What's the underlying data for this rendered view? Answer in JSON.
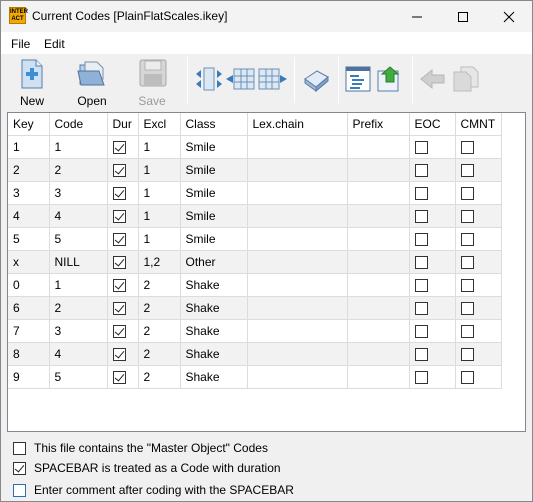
{
  "window": {
    "title": "Current Codes [PlainFlatScales.ikey]",
    "app_icon_text": "INTER ACT"
  },
  "menu": {
    "file": "File",
    "edit": "Edit"
  },
  "toolbar": {
    "new_label": "New",
    "open_label": "Open",
    "save_label": "Save"
  },
  "table": {
    "columns": [
      "Key",
      "Code",
      "Dur",
      "Excl",
      "Class",
      "Lex.chain",
      "Prefix",
      "EOC",
      "CMNT"
    ],
    "rows": [
      {
        "key": "1",
        "code": "1",
        "dur": true,
        "excl": "1",
        "class": "Smile",
        "lex": "",
        "prefix": "",
        "eoc": false,
        "cmnt": false
      },
      {
        "key": "2",
        "code": "2",
        "dur": true,
        "excl": "1",
        "class": "Smile",
        "lex": "",
        "prefix": "",
        "eoc": false,
        "cmnt": false
      },
      {
        "key": "3",
        "code": "3",
        "dur": true,
        "excl": "1",
        "class": "Smile",
        "lex": "",
        "prefix": "",
        "eoc": false,
        "cmnt": false
      },
      {
        "key": "4",
        "code": "4",
        "dur": true,
        "excl": "1",
        "class": "Smile",
        "lex": "",
        "prefix": "",
        "eoc": false,
        "cmnt": false
      },
      {
        "key": "5",
        "code": "5",
        "dur": true,
        "excl": "1",
        "class": "Smile",
        "lex": "",
        "prefix": "",
        "eoc": false,
        "cmnt": false
      },
      {
        "key": "x",
        "code": "NILL",
        "dur": true,
        "excl": "1,2",
        "class": "Other",
        "lex": "",
        "prefix": "",
        "eoc": false,
        "cmnt": false
      },
      {
        "key": "0",
        "code": "1",
        "dur": true,
        "excl": "2",
        "class": "Shake",
        "lex": "",
        "prefix": "",
        "eoc": false,
        "cmnt": false
      },
      {
        "key": "6",
        "code": "2",
        "dur": true,
        "excl": "2",
        "class": "Shake",
        "lex": "",
        "prefix": "",
        "eoc": false,
        "cmnt": false
      },
      {
        "key": "7",
        "code": "3",
        "dur": true,
        "excl": "2",
        "class": "Shake",
        "lex": "",
        "prefix": "",
        "eoc": false,
        "cmnt": false
      },
      {
        "key": "8",
        "code": "4",
        "dur": true,
        "excl": "2",
        "class": "Shake",
        "lex": "",
        "prefix": "",
        "eoc": false,
        "cmnt": false
      },
      {
        "key": "9",
        "code": "5",
        "dur": true,
        "excl": "2",
        "class": "Shake",
        "lex": "",
        "prefix": "",
        "eoc": false,
        "cmnt": false
      }
    ]
  },
  "options": {
    "master_object": {
      "label": "This file contains the \"Master Object\" Codes",
      "checked": false
    },
    "spacebar_duration": {
      "label": "SPACEBAR is treated as a Code with duration",
      "checked": true
    },
    "comment_spacebar": {
      "label": "Enter comment after coding with the SPACEBAR",
      "checked": false
    }
  },
  "colors": {
    "app_icon": "#f2a900",
    "accent_blue": "#2a6fb5",
    "grid_line": "#dcdcdc",
    "alt_row": "#f2f2f2"
  }
}
